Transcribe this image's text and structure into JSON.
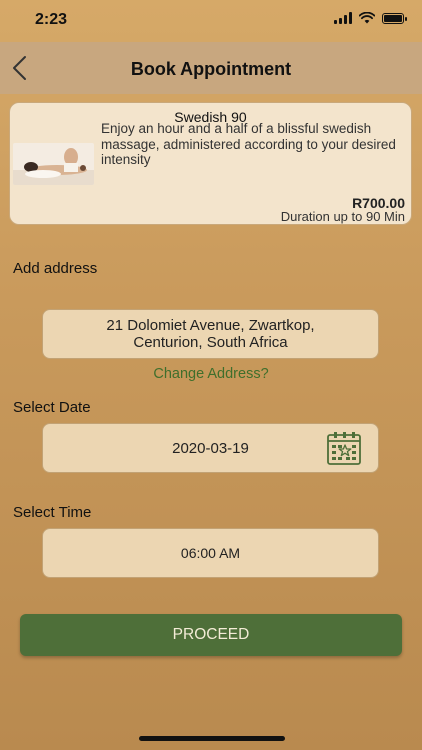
{
  "status_bar": {
    "time": "2:23"
  },
  "nav": {
    "title": "Book Appointment",
    "back_icon": "chevron-left-icon"
  },
  "service": {
    "name": "Swedish 90",
    "description": "Enjoy an hour and a half of a blissful swedish massage, administered according to your desired intensity",
    "price": "R700.00",
    "duration": "Duration up to 90 Min"
  },
  "address": {
    "label": "Add address",
    "line1": "21 Dolomiet Avenue, Zwartkop,",
    "line2": "Centurion, South Africa",
    "change_link": "Change Address?"
  },
  "date": {
    "label": "Select Date",
    "value": "2020-03-19",
    "icon": "calendar-icon"
  },
  "time": {
    "label": "Select Time",
    "value": "06:00 AM"
  },
  "proceed_button": "PROCEED",
  "colors": {
    "background": "#c99a5c",
    "nav_bar": "#c8a77f",
    "card": "#f3e4cc",
    "field": "#ecd6b2",
    "accent_green": "#4e6f39",
    "link_green": "#3f6f2c"
  }
}
